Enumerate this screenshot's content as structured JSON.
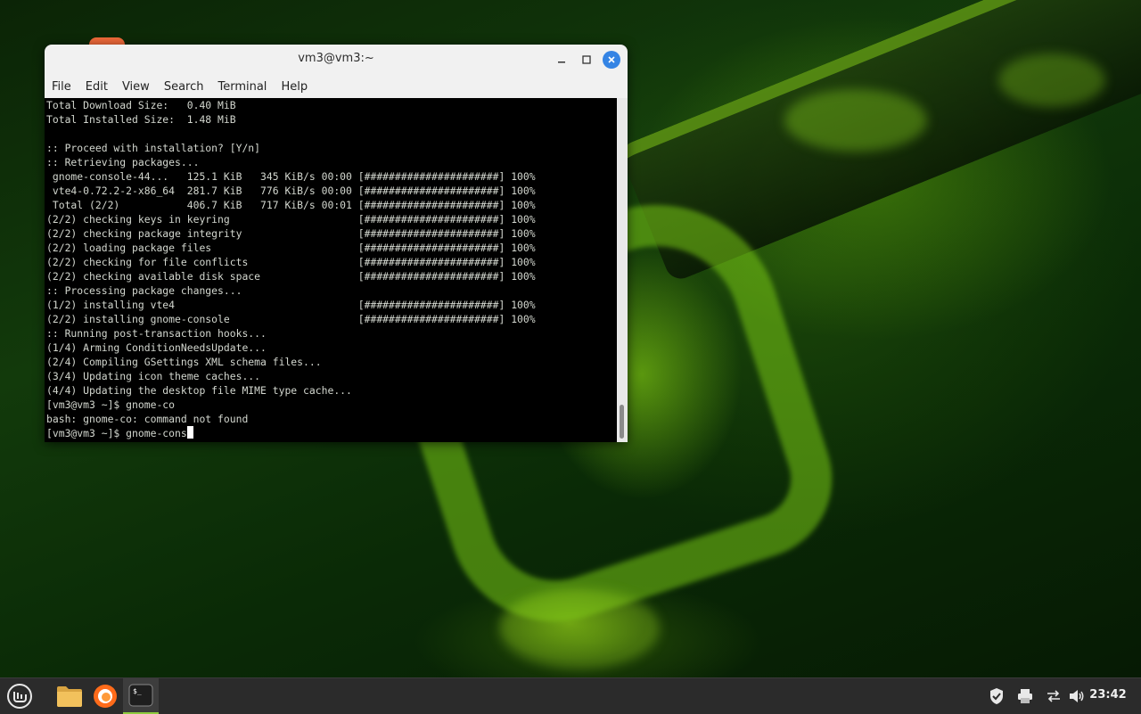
{
  "window": {
    "title": "vm3@vm3:~",
    "menu": [
      "File",
      "Edit",
      "View",
      "Search",
      "Terminal",
      "Help"
    ]
  },
  "terminal": {
    "lines": [
      "Total Download Size:   0.40 MiB",
      "Total Installed Size:  1.48 MiB",
      "",
      ":: Proceed with installation? [Y/n]",
      ":: Retrieving packages...",
      " gnome-console-44...   125.1 KiB   345 KiB/s 00:00 [######################] 100%",
      " vte4-0.72.2-2-x86_64  281.7 KiB   776 KiB/s 00:00 [######################] 100%",
      " Total (2/2)           406.7 KiB   717 KiB/s 00:01 [######################] 100%",
      "(2/2) checking keys in keyring                     [######################] 100%",
      "(2/2) checking package integrity                   [######################] 100%",
      "(2/2) loading package files                        [######################] 100%",
      "(2/2) checking for file conflicts                  [######################] 100%",
      "(2/2) checking available disk space                [######################] 100%",
      ":: Processing package changes...",
      "(1/2) installing vte4                              [######################] 100%",
      "(2/2) installing gnome-console                     [######################] 100%",
      ":: Running post-transaction hooks...",
      "(1/4) Arming ConditionNeedsUpdate...",
      "(2/4) Compiling GSettings XML schema files...",
      "(3/4) Updating icon theme caches...",
      "(4/4) Updating the desktop file MIME type cache...",
      "[vm3@vm3 ~]$ gnome-co",
      "bash: gnome-co: command not found"
    ],
    "prompt_line": "[vm3@vm3 ~]$ gnome-cons"
  },
  "taskbar": {
    "clock": "23:42",
    "icons": [
      "mint-menu-icon",
      "folder-icon",
      "firefox-icon",
      "terminal-icon"
    ],
    "tray": [
      "shield-icon",
      "printer-icon",
      "network-icon",
      "volume-icon"
    ]
  },
  "colors": {
    "accent": "#3584e4",
    "task_highlight": "#8ecb3e",
    "terminal_fg": "#d3d7cf",
    "taskbar_bg": "#2b2b2b"
  }
}
